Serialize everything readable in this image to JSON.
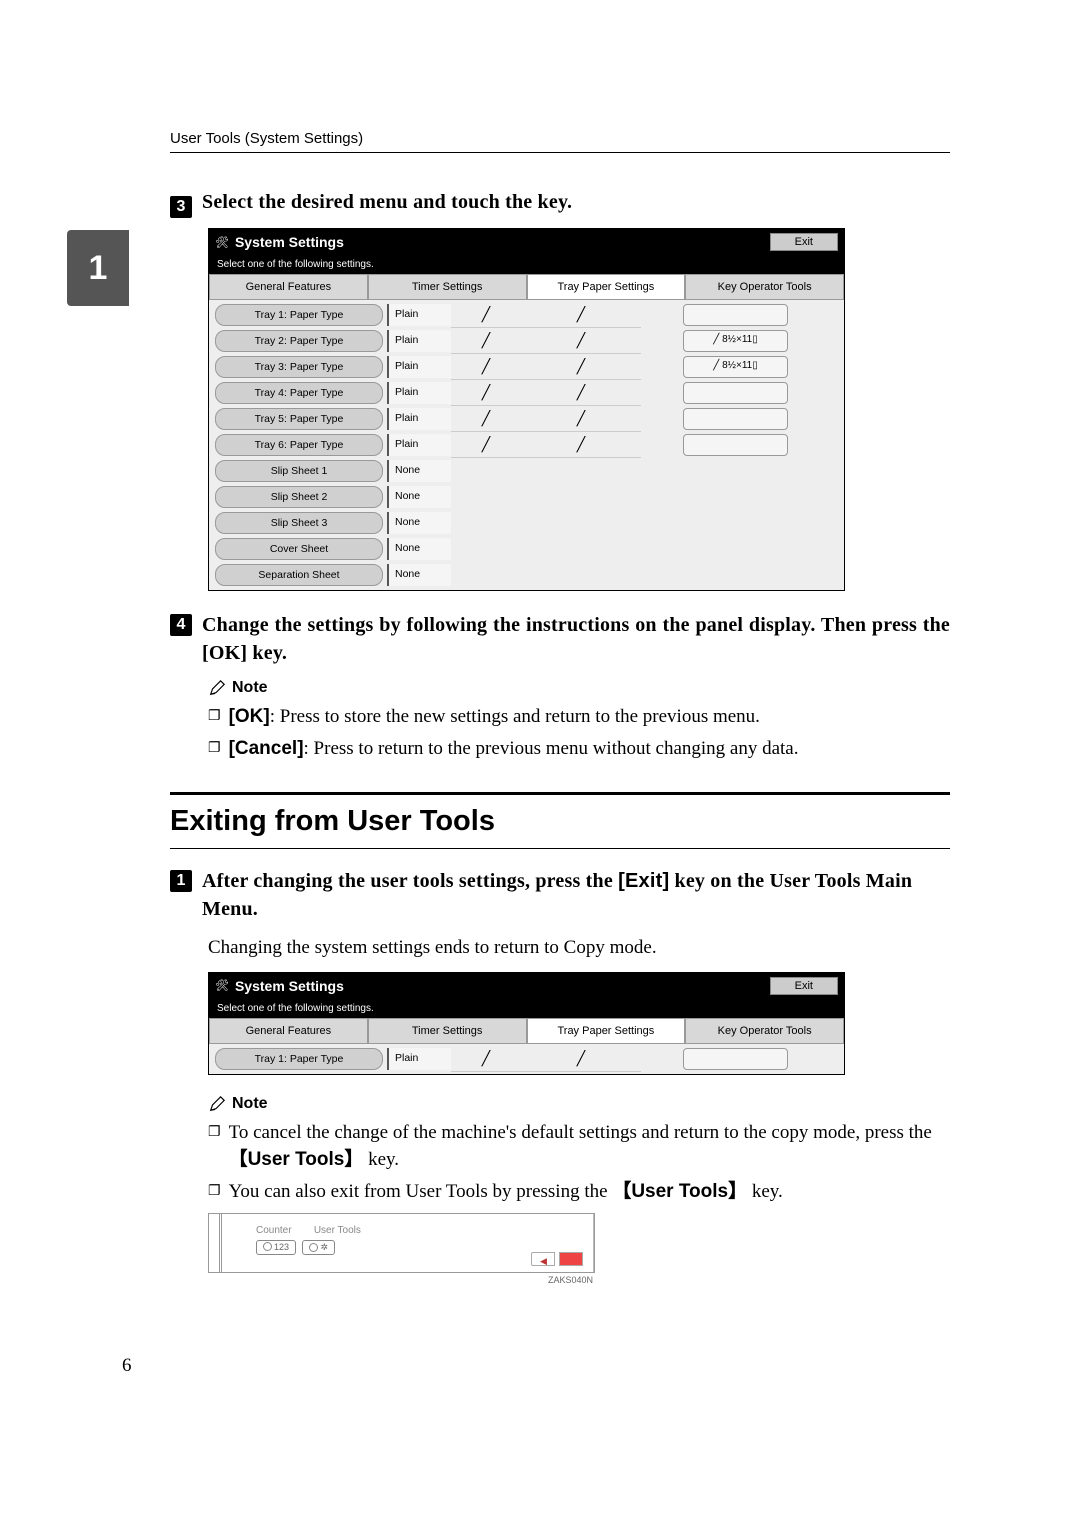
{
  "header": {
    "title": "User Tools (System Settings)"
  },
  "sidetab": {
    "number": "1"
  },
  "step3": {
    "num": "3",
    "text": "Select the desired menu and touch the key."
  },
  "screenshot1": {
    "title": "System Settings",
    "exit": "Exit",
    "subtitle": "Select one of the following settings.",
    "tabs": {
      "general": "General Features",
      "timer": "Timer Settings",
      "tray": "Tray Paper Settings",
      "keyop": "Key Operator Tools"
    },
    "rows": [
      {
        "label": "Tray 1: Paper Type",
        "val": "Plain",
        "c2": "╱",
        "c3": "╱",
        "box": ""
      },
      {
        "label": "Tray 2: Paper Type",
        "val": "Plain",
        "c2": "╱",
        "c3": "╱",
        "box": "╱ 8½×11▯"
      },
      {
        "label": "Tray 3: Paper Type",
        "val": "Plain",
        "c2": "╱",
        "c3": "╱",
        "box": "╱ 8½×11▯"
      },
      {
        "label": "Tray 4: Paper Type",
        "val": "Plain",
        "c2": "╱",
        "c3": "╱",
        "box": ""
      },
      {
        "label": "Tray 5: Paper Type",
        "val": "Plain",
        "c2": "╱",
        "c3": "╱",
        "box": ""
      },
      {
        "label": "Tray 6: Paper Type",
        "val": "Plain",
        "c2": "╱",
        "c3": "╱",
        "box": ""
      },
      {
        "label": "Slip Sheet 1",
        "val": "None"
      },
      {
        "label": "Slip Sheet 2",
        "val": "None"
      },
      {
        "label": "Slip Sheet 3",
        "val": "None"
      },
      {
        "label": "Cover Sheet",
        "val": "None"
      },
      {
        "label": "Separation Sheet",
        "val": "None"
      }
    ]
  },
  "step4": {
    "num": "4",
    "text": "Change the settings by following the instructions on the panel display. Then press the [OK] key."
  },
  "note_label": "Note",
  "bullets1": {
    "ok_key": "[OK]",
    "ok_text": ": Press to store the new settings and return to the previous menu.",
    "cancel_key": "[Cancel]",
    "cancel_text": ": Press to return to the previous menu without changing any data."
  },
  "section": {
    "title": "Exiting from User Tools"
  },
  "step_exit": {
    "num": "1",
    "part1": "After changing the user tools settings, press the ",
    "key": "[Exit]",
    "part2": " key on the User Tools Main Menu."
  },
  "body1": "Changing the system settings ends to return to Copy mode.",
  "screenshot2": {
    "title": "System Settings",
    "exit": "Exit",
    "subtitle": "Select one of the following settings.",
    "row": {
      "label": "Tray 1: Paper Type",
      "val": "Plain",
      "c2": "╱",
      "c3": "╱"
    }
  },
  "bullets2": {
    "line1a": "To cancel the change of the machine's default settings and return to the copy mode, press the ",
    "ut_key": "【User Tools】",
    "line1b": " key.",
    "line2a": "You can also exit from User Tools by pressing the ",
    "line2b": " key."
  },
  "panel": {
    "counter": "Counter",
    "usertools": "User Tools",
    "code": "ZAKS040N"
  },
  "page_number": "6"
}
